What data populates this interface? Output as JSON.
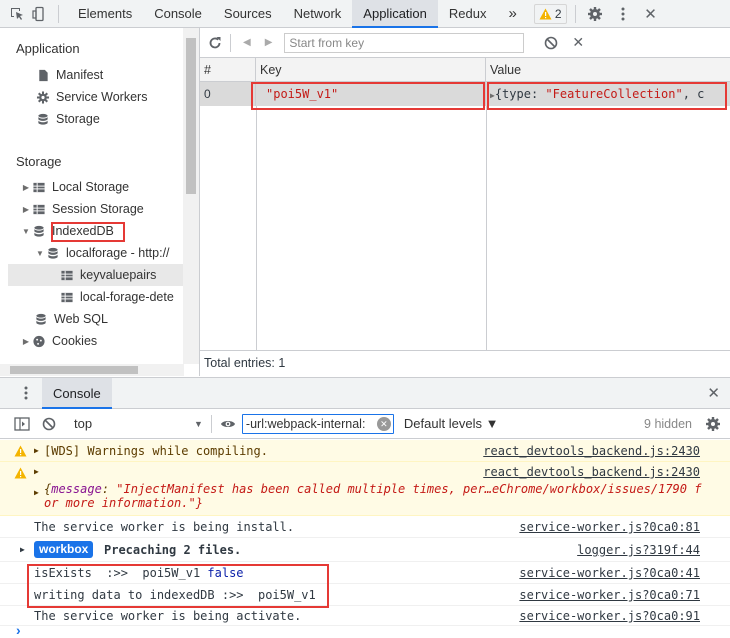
{
  "topbar": {
    "tabs": [
      "Elements",
      "Console",
      "Sources",
      "Network",
      "Application",
      "Redux"
    ],
    "active_tab": "Application",
    "more": "»",
    "warning_count": "2",
    "close": "✕"
  },
  "sidebar": {
    "application_heading": "Application",
    "application_items": [
      "Manifest",
      "Service Workers",
      "Storage"
    ],
    "storage_heading": "Storage",
    "local_storage": "Local Storage",
    "session_storage": "Session Storage",
    "indexeddb": "IndexedDB",
    "localforage": "localforage - http://",
    "keyvaluepairs": "keyvaluepairs",
    "local_forage_detect": "local-forage-dete",
    "web_sql": "Web SQL",
    "cookies": "Cookies"
  },
  "main": {
    "filter_placeholder": "Start from key",
    "columns": [
      "#",
      "Key",
      "Value"
    ],
    "rows": [
      {
        "index": "0",
        "key": "\"poi5W_v1\"",
        "value_prefix": "{type: ",
        "value_str": "\"FeatureCollection\"",
        "value_suffix": ", c"
      }
    ],
    "total_entries": "Total entries: 1"
  },
  "drawer": {
    "tab": "Console",
    "context": "top",
    "filter_value": "-url:webpack-internal:",
    "levels": "Default levels ▼",
    "hidden": "9 hidden"
  },
  "console": {
    "lines": [
      {
        "kind": "warn",
        "text": "[WDS] Warnings while compiling.",
        "source": "react_devtools_backend.js:2430"
      },
      {
        "kind": "warn",
        "text": "",
        "source": "react_devtools_backend.js:2430",
        "obj_open": "{",
        "obj_key": "message",
        "obj_colon": ": ",
        "obj_value_1": "\"InjectManifest has been called multiple times, per…eChrome/workbox/issues/1790 f",
        "obj_value_2": "or more information.\"}"
      },
      {
        "kind": "log",
        "text": "The service worker is being install.",
        "source": "service-worker.js?0ca0:81"
      },
      {
        "kind": "log",
        "badge": "workbox",
        "text": "Precaching 2 files.",
        "source": "logger.js?319f:44"
      },
      {
        "kind": "log",
        "text": "isExists  :>>  poi5W_v1 ",
        "bool": "false",
        "source": "service-worker.js?0ca0:41"
      },
      {
        "kind": "log",
        "text": "writing data to indexedDB :>>  poi5W_v1",
        "source": "service-worker.js?0ca0:71"
      },
      {
        "kind": "log",
        "text": "The service worker is being activate.",
        "source": "service-worker.js?0ca0:91"
      }
    ],
    "prompt": "›"
  },
  "colors": {
    "accent": "#1a73e8",
    "highlight": "#e53935",
    "string": "#c41a16",
    "badge": "#1a73e8"
  }
}
